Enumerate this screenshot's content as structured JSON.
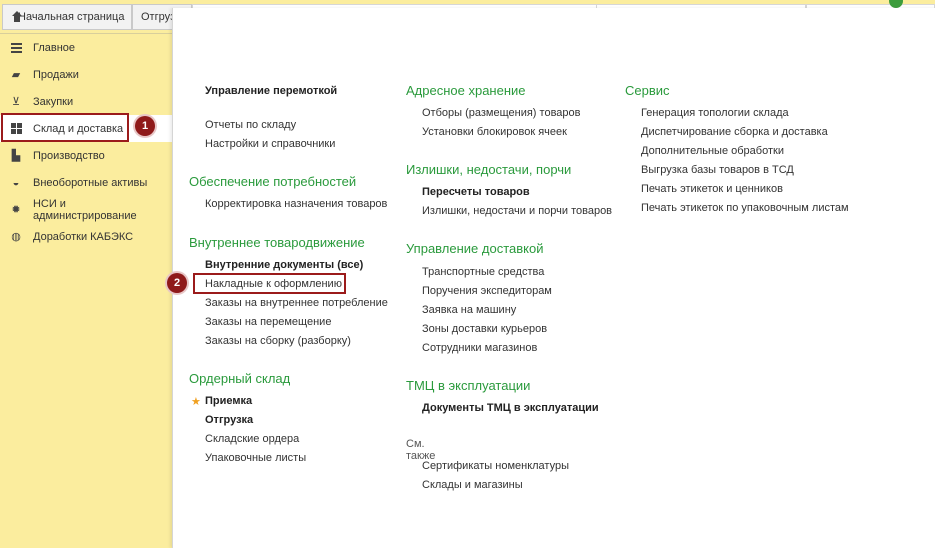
{
  "tabs": [
    {
      "label": "Начальная страница"
    },
    {
      "label": "Отгруз"
    }
  ],
  "sidebar": {
    "items": [
      {
        "label": "Главное",
        "icon": "menu-icon"
      },
      {
        "label": "Продажи",
        "icon": "bag-icon"
      },
      {
        "label": "Закупки",
        "icon": "cart-icon"
      },
      {
        "label": "Склад и доставка",
        "icon": "grid-icon"
      },
      {
        "label": "Производство",
        "icon": "factory-icon"
      },
      {
        "label": "Внеоборотные активы",
        "icon": "car-icon"
      },
      {
        "label": "НСИ и администрирование",
        "icon": "gear-icon"
      },
      {
        "label": "Доработки КАБЭКС",
        "icon": "coins-icon"
      }
    ]
  },
  "badges": {
    "b1": "1",
    "b2": "2"
  },
  "col1": {
    "top_title": "Управление перемоткой",
    "links_a": [
      "Отчеты по складу",
      "Настройки и справочники"
    ],
    "s1": {
      "title": "Обеспечение потребностей",
      "links": [
        "Корректировка назначения товаров"
      ]
    },
    "s2": {
      "title": "Внутреннее товародвижение",
      "bold": "Внутренние документы (все)",
      "links": [
        "Накладные к оформлению",
        "Заказы на внутреннее потребление",
        "Заказы на перемещение",
        "Заказы на сборку (разборку)"
      ]
    },
    "s3": {
      "title": "Ордерный склад",
      "bold1": "Приемка",
      "bold2": "Отгрузка",
      "links": [
        "Складские ордера",
        "Упаковочные листы"
      ]
    }
  },
  "col2": {
    "s1": {
      "title": "Адресное хранение",
      "links": [
        "Отборы (размещения) товаров",
        "Установки блокировок ячеек"
      ]
    },
    "s2": {
      "title": "Излишки, недостачи, порчи",
      "bold": "Пересчеты товаров",
      "links": [
        "Излишки, недостачи и порчи товаров"
      ]
    },
    "s3": {
      "title": "Управление доставкой",
      "links": [
        "Транспортные средства",
        "Поручения экспедиторам",
        "Заявка на машину",
        "Зоны доставки курьеров",
        "Сотрудники магазинов"
      ]
    },
    "s4": {
      "title": "ТМЦ в эксплуатации",
      "bold": "Документы ТМЦ в эксплуатации"
    },
    "see_also": "См. также",
    "see_links": [
      "Сертификаты номенклатуры",
      "Склады и магазины"
    ]
  },
  "col3": {
    "s1": {
      "title": "Сервис",
      "links": [
        "Генерация топологии склада",
        "Диспетчирование сборка и доставка",
        "Дополнительные обработки",
        "Выгрузка базы товаров в ТСД",
        "Печать этикеток и ценников",
        "Печать этикеток по упаковочным листам"
      ]
    }
  }
}
